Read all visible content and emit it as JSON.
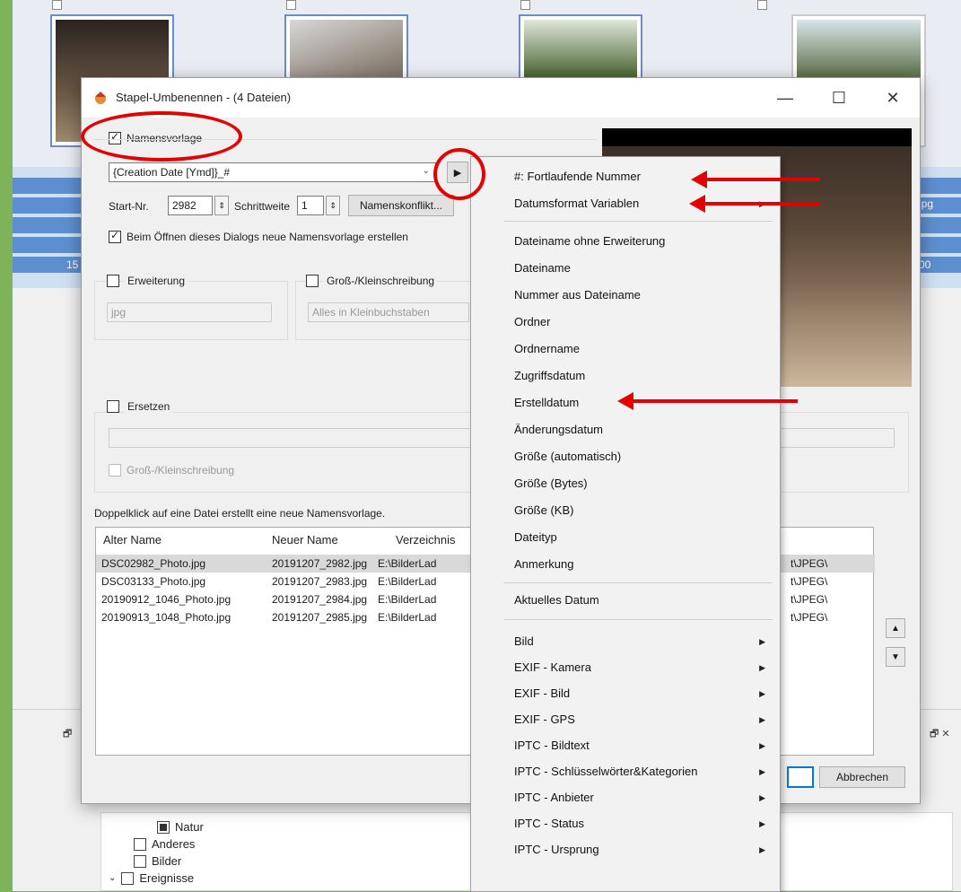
{
  "dialog": {
    "title": "Stapel-Umbenennen - (4 Dateien)",
    "name_template_label": "Namensvorlage",
    "name_template_value": "{Creation Date [Ymd]}_#",
    "start_label": "Start-Nr.",
    "start_value": "2982",
    "step_label": "Schrittweite",
    "step_value": "1",
    "conflict_button": "Namenskonflikt...",
    "new_template_label": "Beim Öffnen dieses Dialogs neue Namensvorlage erstellen",
    "extension_label": "Erweiterung",
    "extension_value": "jpg",
    "case_label": "Groß-/Kleinschreibung",
    "case_value": "Alles in Kleinbuchstaben",
    "replace_label": "Ersetzen",
    "replace_case_label": "Groß-/Kleinschreibung",
    "hint": "Doppelklick auf eine Datei erstellt eine neue Namensvorlage.",
    "cancel_button": "Abbrechen",
    "table": {
      "headers": [
        "Alter Name",
        "Neuer Name",
        "Verzeichnis"
      ],
      "rows": [
        {
          "old": "DSC02982_Photo.jpg",
          "new": "20191207_2982.jpg",
          "dir": "E:\\BilderLad",
          "tail": "t\\JPEG\\"
        },
        {
          "old": "DSC03133_Photo.jpg",
          "new": "20191207_2983.jpg",
          "dir": "E:\\BilderLad",
          "tail": "t\\JPEG\\"
        },
        {
          "old": "20190912_1046_Photo.jpg",
          "new": "20191207_2984.jpg",
          "dir": "E:\\BilderLad",
          "tail": "t\\JPEG\\"
        },
        {
          "old": "20190913_1048_Photo.jpg",
          "new": "20191207_2985.jpg",
          "dir": "E:\\BilderLad",
          "tail": "t\\JPEG\\"
        }
      ]
    }
  },
  "menu": {
    "items": [
      {
        "label": "#: Fortlaufende Nummer",
        "sub": false
      },
      {
        "label": "Datumsformat Variablen",
        "sub": true
      },
      {
        "label": "Dateiname ohne Erweiterung",
        "sub": false
      },
      {
        "label": "Dateiname",
        "sub": false
      },
      {
        "label": "Nummer aus Dateiname",
        "sub": false
      },
      {
        "label": "Ordner",
        "sub": false
      },
      {
        "label": "Ordnername",
        "sub": false
      },
      {
        "label": "Zugriffsdatum",
        "sub": false
      },
      {
        "label": "Erstelldatum",
        "sub": false
      },
      {
        "label": "Änderungsdatum",
        "sub": false
      },
      {
        "label": "Größe (automatisch)",
        "sub": false
      },
      {
        "label": "Größe (Bytes)",
        "sub": false
      },
      {
        "label": "Größe (KB)",
        "sub": false
      },
      {
        "label": "Dateityp",
        "sub": false
      },
      {
        "label": "Anmerkung",
        "sub": false
      },
      {
        "label": "Aktuelles Datum",
        "sub": false
      },
      {
        "label": "Bild",
        "sub": true
      },
      {
        "label": "EXIF - Kamera",
        "sub": true
      },
      {
        "label": "EXIF - Bild",
        "sub": true
      },
      {
        "label": "EXIF - GPS",
        "sub": true
      },
      {
        "label": "IPTC - Bildtext",
        "sub": true
      },
      {
        "label": "IPTC - Schlüsselwörter&Kategorien",
        "sub": true
      },
      {
        "label": "IPTC - Anbieter",
        "sub": true
      },
      {
        "label": "IPTC - Status",
        "sub": true
      },
      {
        "label": "IPTC - Ursprung",
        "sub": true
      }
    ]
  },
  "background": {
    "tree_items": [
      "Natur",
      "Anderes",
      "Bilder",
      "Ereignisse"
    ],
    "row_snippets": [
      "jpg",
      "15",
      "00"
    ]
  },
  "colors": {
    "accent_red": "#e30000",
    "selection_blue": "#5d8fd0"
  }
}
